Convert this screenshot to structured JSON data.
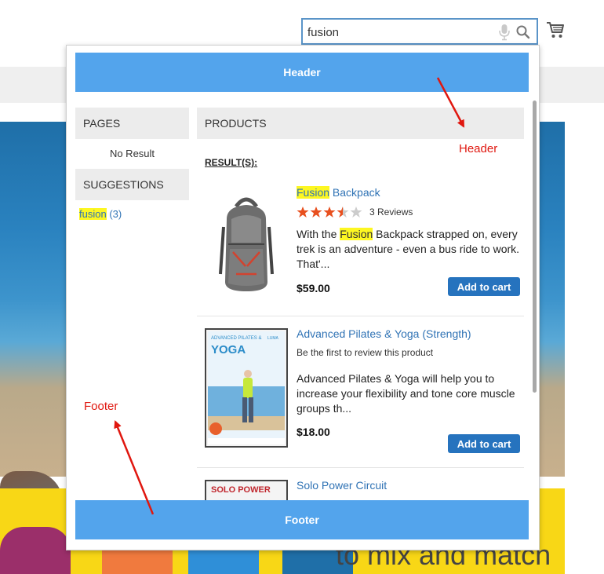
{
  "search": {
    "value": "fusion"
  },
  "dropdown": {
    "header_label": "Header",
    "footer_label": "Footer",
    "pages": {
      "title": "PAGES",
      "empty_text": "No Result"
    },
    "suggestions": {
      "title": "SUGGESTIONS",
      "items": [
        {
          "term": "fusion",
          "count": "(3)"
        }
      ]
    },
    "products": {
      "title": "PRODUCTS",
      "results_label": "RESULT(S):",
      "items": [
        {
          "name_highlight": "Fusion",
          "name_rest": " Backpack",
          "rating": 3.5,
          "reviews": "3 Reviews",
          "desc_before": "With the ",
          "desc_highlight": "Fusion",
          "desc_after": " Backpack strapped on, every trek is an adventure - even a bus ride to work. That'...",
          "price": "$59.00",
          "button": "Add to cart"
        },
        {
          "name": "Advanced Pilates & Yoga (Strength)",
          "review_prompt": "Be the first to review this product",
          "desc": "Advanced Pilates & Yoga will help you to increase your flexibility and tone core muscle groups th...",
          "price": "$18.00",
          "button": "Add to cart",
          "cover_title_top": "ADVANCED PILATES &",
          "cover_title_big": "YOGA",
          "cover_brand": "LUMA"
        },
        {
          "name": "Solo Power Circuit",
          "cover_title": "SOLO POWER"
        }
      ]
    }
  },
  "annotations": {
    "header": "Header",
    "footer": "Footer"
  },
  "background": {
    "promo_text": "to mix and match"
  },
  "colors": {
    "accent": "#53a4ec",
    "button": "#2673be",
    "highlight": "#fdf722",
    "annotation": "#e0170f",
    "star": "#e8501f"
  },
  "icons": [
    "mic-icon",
    "search-icon",
    "cart-icon",
    "star-icon"
  ]
}
